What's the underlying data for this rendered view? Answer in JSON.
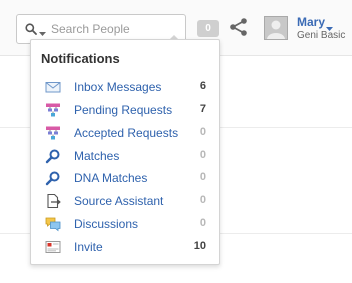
{
  "header": {
    "search": {
      "placeholder": "Search People"
    },
    "notification_count": "0",
    "user": {
      "name": "Mary",
      "plan": "Geni Basic"
    }
  },
  "notifications": {
    "title": "Notifications",
    "items": [
      {
        "label": "Inbox Messages",
        "count": "6",
        "icon": "envelope-icon"
      },
      {
        "label": "Pending Requests",
        "count": "7",
        "icon": "tree-request-icon"
      },
      {
        "label": "Accepted Requests",
        "count": "0",
        "icon": "tree-request-icon"
      },
      {
        "label": "Matches",
        "count": "0",
        "icon": "magnifier-icon"
      },
      {
        "label": "DNA Matches",
        "count": "0",
        "icon": "magnifier-icon"
      },
      {
        "label": "Source Assistant",
        "count": "0",
        "icon": "document-arrow-icon"
      },
      {
        "label": "Discussions",
        "count": "0",
        "icon": "speech-bubbles-icon"
      },
      {
        "label": "Invite",
        "count": "10",
        "icon": "invite-card-icon"
      }
    ]
  },
  "colors": {
    "link": "#2f62ad",
    "username": "#3b6bb5",
    "count_nonzero": "#444444",
    "count_zero": "#b8b8b8"
  }
}
